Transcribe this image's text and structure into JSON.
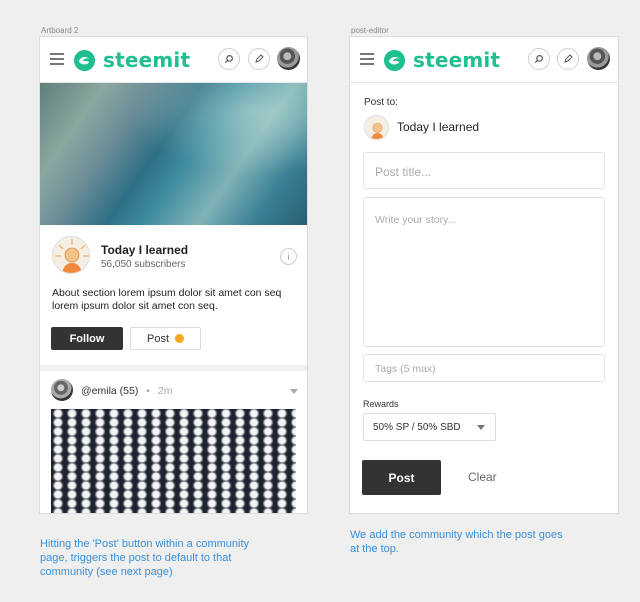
{
  "artboards": [
    {
      "label": "Artboard 2"
    },
    {
      "label": "post-editor"
    }
  ],
  "header": {
    "logo_text": "steemit",
    "brand_color": "#1fbf8f"
  },
  "community_page": {
    "name": "Today I learned",
    "subscribers": "56,050 subscribers",
    "about": "About section lorem ipsum dolor sit amet con seq lorem ipsum dolor sit amet con seq.",
    "follow_label": "Follow",
    "post_label": "Post",
    "info_icon": "i",
    "feed": {
      "author": "@emila (55)",
      "separator": "•",
      "time": "2m"
    }
  },
  "editor": {
    "post_to_label": "Post to:",
    "community_name": "Today I learned",
    "title_placeholder": "Post title...",
    "body_placeholder": "Write your story...",
    "tags_placeholder": "Tags (5 max)",
    "rewards_label": "Rewards",
    "rewards_value": "50% SP / 50% SBD",
    "post_label": "Post",
    "clear_label": "Clear"
  },
  "captions": {
    "left": [
      "Hitting the 'Post' button within a community",
      "page, triggers the post to default to that",
      "community (see next page)"
    ],
    "right": [
      "We add the community which the post goes",
      "at the top."
    ]
  },
  "colors": {
    "accent": "#1fbf8f",
    "caption": "#3a8fd6",
    "dark_button": "#333333",
    "notification_dot": "#f5a623"
  }
}
